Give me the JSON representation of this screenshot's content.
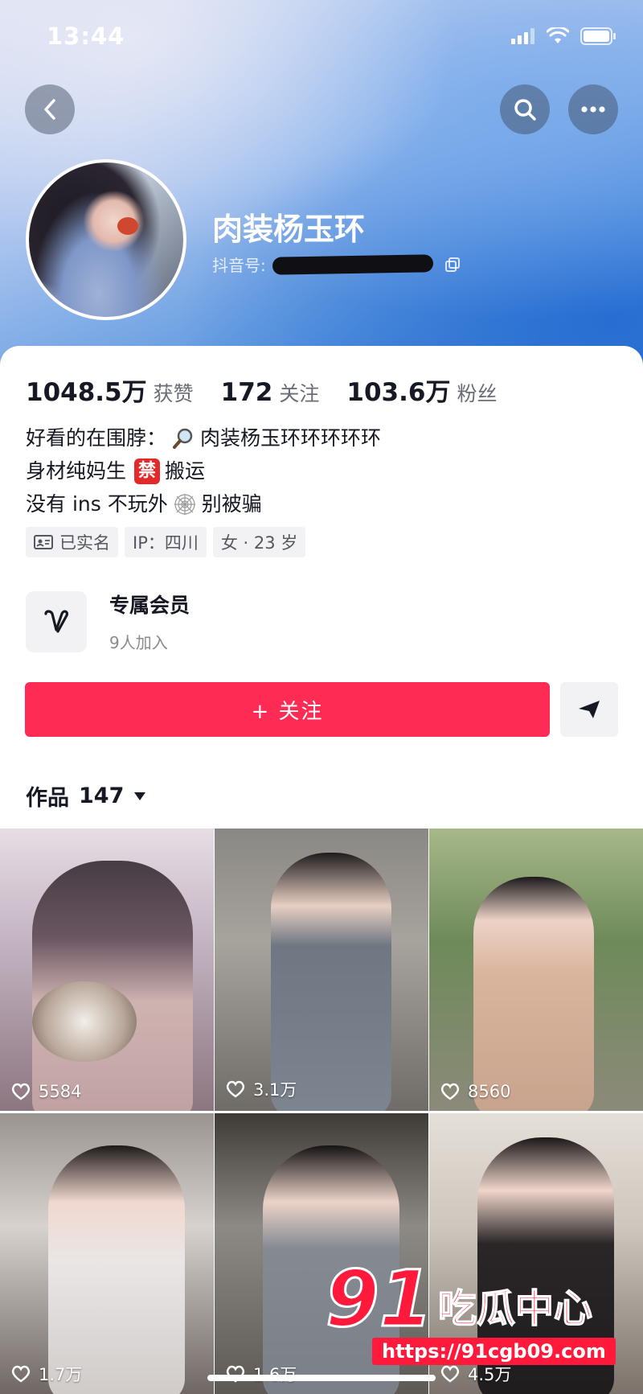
{
  "status_bar": {
    "time": "13:44"
  },
  "profile": {
    "username": "肉装杨玉环",
    "douyin_id_label": "抖音号:"
  },
  "stats": [
    {
      "value": "1048.5万",
      "label": "获赞"
    },
    {
      "value": "172",
      "label": "关注"
    },
    {
      "value": "103.6万",
      "label": "粉丝"
    }
  ],
  "bio": {
    "line1_prefix": "好看的在围脖：",
    "line1_suffix": "肉装杨玉环环环环环",
    "line2_prefix": "身材纯妈生",
    "line2_badge": "禁",
    "line2_suffix": "搬运",
    "line3_prefix": "没有 ins 不玩外",
    "line3_suffix": "别被骗"
  },
  "tags": {
    "verified": "已实名",
    "ip": "IP：四川",
    "gender_age": "女 · 23 岁"
  },
  "member": {
    "title": "专属会员",
    "subtitle": "9人加入"
  },
  "follow_button": "+ 关注",
  "works": {
    "label": "作品",
    "count": "147"
  },
  "videos": [
    {
      "likes": "5584"
    },
    {
      "likes": "3.1万"
    },
    {
      "likes": "8560"
    },
    {
      "likes": "1.7万"
    },
    {
      "likes": "1.6万"
    },
    {
      "likes": "4.5万"
    }
  ],
  "watermark": {
    "number": "91",
    "text": "吃瓜中心",
    "url": "https://91cgb09.com"
  },
  "colors": {
    "accent": "#fe2c55",
    "watermark": "#ff1a3c"
  }
}
